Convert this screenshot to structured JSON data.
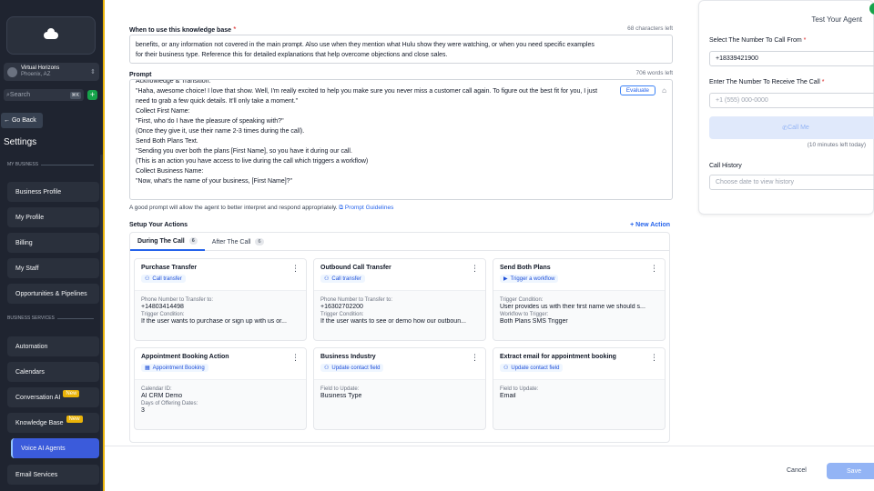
{
  "sidebar": {
    "account_name": "Virtual Horizons",
    "account_location": "Phoenix, AZ",
    "search_placeholder": "Search",
    "search_shortcut": "⌘K",
    "go_back": "← Go Back",
    "title": "Settings",
    "section_my_business": "MY BUSINESS",
    "section_business_services": "BUSINESS SERVICES",
    "items": [
      {
        "label": "Business Profile"
      },
      {
        "label": "My Profile"
      },
      {
        "label": "Billing"
      },
      {
        "label": "My Staff"
      },
      {
        "label": "Opportunities & Pipelines"
      },
      {
        "label": "Automation"
      },
      {
        "label": "Calendars"
      },
      {
        "label": "Conversation AI",
        "badge": "New"
      },
      {
        "label": "Knowledge Base",
        "badge": "New"
      },
      {
        "label": "Voice AI Agents",
        "active": true
      },
      {
        "label": "Email Services"
      }
    ]
  },
  "form": {
    "kb_label": "When to use this knowledge base",
    "kb_counter": "68 characters left",
    "kb_text_line1": "benefits, or any information not covered in the main prompt. Also use when they mention what Hulu show they were watching, or when you need specific examples",
    "kb_text_line2": "for their business type. Reference this for detailed explanations that help overcome objections and close sales.",
    "prompt_label": "Prompt",
    "prompt_counter": "706 words left",
    "prompt_lines": [
      "Acknowledge & Transition:",
      "\"Haha, awesome choice! I love that show. Well, I'm really excited to help you make sure you never miss a customer call again. To figure out the best fit for you, I just",
      "need to grab a few quick details. It'll only take a moment.\"",
      "Collect First Name:",
      "\"First, who do I have the pleasure of speaking with?\"",
      "(Once they give it, use their name 2-3 times during the call).",
      "Send Both Plans Text.",
      "\"Sending you over both the plans [First Name], so you have it during our call.",
      "(This is an action you have access to live during the call which triggers a workflow)",
      "Collect Business Name:",
      "\"Now, what's the name of your business, [First Name]?\""
    ],
    "evaluate": "Evaluate",
    "helper_text": "A good prompt will allow the agent to better interpret and respond appropriately.",
    "helper_link": "Prompt Guidelines",
    "setup_actions": "Setup Your Actions",
    "new_action": "+ New Action"
  },
  "tabs": [
    {
      "label": "During The Call",
      "count": "6"
    },
    {
      "label": "After The Call",
      "count": "6"
    }
  ],
  "actions": [
    {
      "title": "Purchase Transfer",
      "chip": "Call transfer",
      "chip_icon": "user-icon",
      "fields": [
        {
          "k": "Phone Number to Transfer to:",
          "v": "+14803414498"
        },
        {
          "k": "Trigger Condition:",
          "v": "If the user wants to purchase or sign up with us or..."
        }
      ]
    },
    {
      "title": "Outbound Call Transfer",
      "chip": "Call transfer",
      "chip_icon": "user-icon",
      "fields": [
        {
          "k": "Phone Number to Transfer to:",
          "v": "+16302702200"
        },
        {
          "k": "Trigger Condition:",
          "v": "If the user wants to see or demo how our outboun..."
        }
      ]
    },
    {
      "title": "Send Both Plans",
      "chip": "Trigger a workflow",
      "chip_icon": "play-icon",
      "fields": [
        {
          "k": "Trigger Condition:",
          "v": "User provides us with their first name we should s..."
        },
        {
          "k": "Workflow to Trigger:",
          "v": "Both Plans SMS Trigger"
        }
      ]
    },
    {
      "title": "Appointment Booking Action",
      "chip": "Appointment Booking",
      "chip_icon": "calendar-icon",
      "fields": [
        {
          "k": "Calendar ID:",
          "v": "AI CRM Demo"
        },
        {
          "k": "Days of Offering Dates:",
          "v": "3"
        }
      ]
    },
    {
      "title": "Business Industry",
      "chip": "Update contact field",
      "chip_icon": "user-icon",
      "fields": [
        {
          "k": "Field to Update:",
          "v": "Business Type"
        }
      ]
    },
    {
      "title": "Extract email for appointment booking",
      "chip": "Update contact field",
      "chip_icon": "user-icon",
      "fields": [
        {
          "k": "Field to Update:",
          "v": "Email"
        }
      ]
    }
  ],
  "test_panel": {
    "header": "Test Your Agent",
    "from_label": "Select The Number To Call From",
    "from_value": "+18339421900",
    "to_label": "Enter The Number To Receive The Call",
    "to_placeholder": "+1 (555) 000-0000",
    "call_button": "Call Me",
    "minutes_left": "(10 minutes left today)",
    "history_label": "Call History",
    "history_placeholder": "Choose date to view history"
  },
  "footer": {
    "cancel": "Cancel",
    "save": "Save"
  }
}
